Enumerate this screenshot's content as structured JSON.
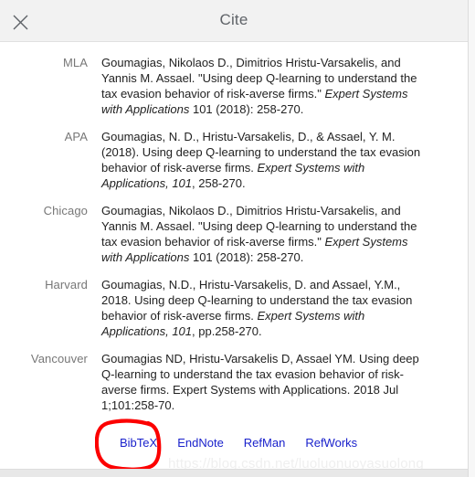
{
  "header": {
    "title": "Cite",
    "close_icon": "close-icon"
  },
  "citations": [
    {
      "label": "MLA",
      "parts": [
        {
          "text": "Goumagias, Nikolaos D., Dimitrios Hristu-Varsakelis, and Yannis M. Assael. \"Using deep Q-learning to understand the tax evasion behavior of risk-averse firms.\" ",
          "italic": false
        },
        {
          "text": "Expert Systems with Applications",
          "italic": true
        },
        {
          "text": " 101 (2018): 258-270.",
          "italic": false
        }
      ]
    },
    {
      "label": "APA",
      "parts": [
        {
          "text": "Goumagias, N. D., Hristu-Varsakelis, D., & Assael, Y. M. (2018). Using deep Q-learning to understand the tax evasion behavior of risk-averse firms. ",
          "italic": false
        },
        {
          "text": "Expert Systems with Applications, 101",
          "italic": true
        },
        {
          "text": ", 258-270.",
          "italic": false
        }
      ]
    },
    {
      "label": "Chicago",
      "parts": [
        {
          "text": "Goumagias, Nikolaos D., Dimitrios Hristu-Varsakelis, and Yannis M. Assael. \"Using deep Q-learning to understand the tax evasion behavior of risk-averse firms.\" ",
          "italic": false
        },
        {
          "text": "Expert Systems with Applications",
          "italic": true
        },
        {
          "text": " 101 (2018): 258-270.",
          "italic": false
        }
      ]
    },
    {
      "label": "Harvard",
      "parts": [
        {
          "text": "Goumagias, N.D., Hristu-Varsakelis, D. and Assael, Y.M., 2018. Using deep Q-learning to understand the tax evasion behavior of risk-averse firms. ",
          "italic": false
        },
        {
          "text": "Expert Systems with Applications, 101",
          "italic": true
        },
        {
          "text": ", pp.258-270.",
          "italic": false
        }
      ]
    },
    {
      "label": "Vancouver",
      "parts": [
        {
          "text": "Goumagias ND, Hristu-Varsakelis D, Assael YM. Using deep Q-learning to understand the tax evasion behavior of risk-averse firms. Expert Systems with Applications. 2018 Jul 1;101:258-70.",
          "italic": false
        }
      ]
    }
  ],
  "export_links": [
    {
      "label": "BibTeX"
    },
    {
      "label": "EndNote"
    },
    {
      "label": "RefMan"
    },
    {
      "label": "RefWorks"
    }
  ],
  "watermark": "https://blog.csdn.net/luoluonuoyasuolong",
  "colors": {
    "link": "#1a22cc",
    "label": "#777777",
    "title": "#5f6368",
    "header_bg": "#f2f2f2",
    "annotation": "#fc0000"
  }
}
